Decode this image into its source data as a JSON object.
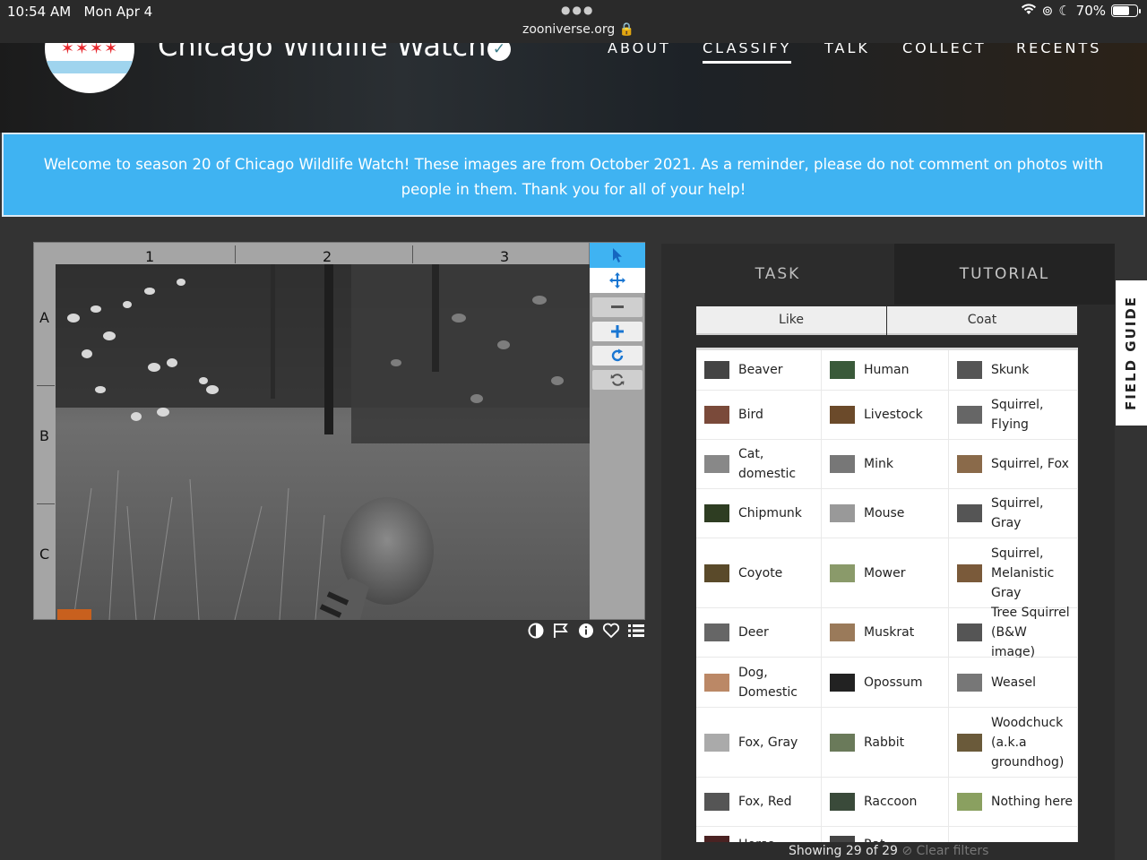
{
  "status_bar": {
    "time": "10:54 AM",
    "date": "Mon Apr 4",
    "url": "zooniverse.org",
    "battery": "70%",
    "battery_level": 0.7
  },
  "header": {
    "project_title": "Chicago Wildlife Watch",
    "nav": [
      {
        "label": "ABOUT",
        "active": false
      },
      {
        "label": "CLASSIFY",
        "active": true
      },
      {
        "label": "TALK",
        "active": false
      },
      {
        "label": "COLLECT",
        "active": false
      },
      {
        "label": "RECENTS",
        "active": false
      }
    ]
  },
  "announcement": "Welcome to season 20 of Chicago Wildlife Watch! These images are from October 2021. As a reminder, please do not comment on photos with people in them. Thank you for all of your help!",
  "viewer": {
    "columns": [
      "1",
      "2",
      "3"
    ],
    "rows": [
      "A",
      "B",
      "C"
    ],
    "tools": [
      "pointer-icon",
      "move-icon",
      "zoom-out-icon",
      "zoom-in-icon",
      "rotate-icon",
      "reset-icon"
    ],
    "meta_icons": [
      "invert-icon",
      "flag-icon",
      "info-icon",
      "favorite-icon",
      "collections-icon"
    ]
  },
  "task_panel": {
    "tabs": [
      "TASK",
      "TUTORIAL"
    ],
    "filters": [
      "Like",
      "Coat"
    ],
    "choices": [
      [
        "Beaver",
        "Human",
        "Skunk"
      ],
      [
        "Bird",
        "Livestock",
        "Squirrel, Flying"
      ],
      [
        "Cat, domestic",
        "Mink",
        "Squirrel, Fox"
      ],
      [
        "Chipmunk",
        "Mouse",
        "Squirrel, Gray"
      ],
      [
        "Coyote",
        "Mower",
        "Squirrel, Melanistic Gray"
      ],
      [
        "Deer",
        "Muskrat",
        "Tree Squirrel (B&W image)"
      ],
      [
        "Dog, Domestic",
        "Opossum",
        "Weasel"
      ],
      [
        "Fox, Gray",
        "Rabbit",
        "Woodchuck (a.k.a groundhog)"
      ],
      [
        "Fox, Red",
        "Raccoon",
        "Nothing here"
      ],
      [
        "Horse",
        "Rat",
        ""
      ]
    ],
    "showing": "Showing 29 of 29",
    "clear_filters": "Clear filters",
    "field_guide": "FIELD GUIDE"
  }
}
